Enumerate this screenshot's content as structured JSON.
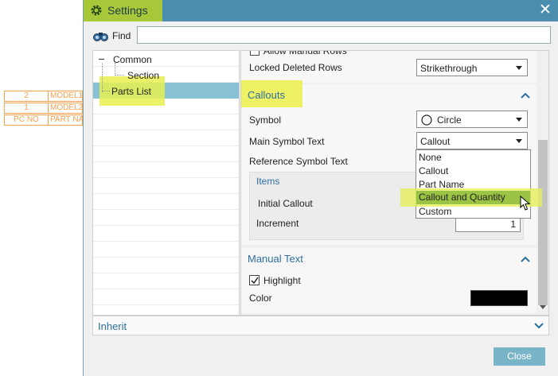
{
  "background_table": {
    "rows": [
      [
        "2",
        "MODEL1"
      ],
      [
        "1",
        "MODEL2"
      ],
      [
        "PC NO",
        "PART NA"
      ]
    ]
  },
  "dialog": {
    "title": "Settings",
    "find_label": "Find",
    "find_value": "",
    "tree": {
      "items": [
        {
          "label": "Common",
          "expander": "−"
        },
        {
          "label": "Section"
        },
        {
          "label": "Parts List"
        }
      ]
    },
    "rows_section": {
      "partial_label": "Allow Manual Rows",
      "locked_deleted_rows_label": "Locked Deleted Rows",
      "locked_deleted_rows_value": "Strikethrough"
    },
    "callouts": {
      "title": "Callouts",
      "symbol_label": "Symbol",
      "symbol_value": "Circle",
      "main_symbol_text_label": "Main Symbol Text",
      "main_symbol_text_value": "Callout",
      "reference_symbol_text_label": "Reference Symbol Text",
      "items_title": "Items",
      "initial_callout_label": "Initial Callout",
      "increment_label": "Increment",
      "increment_value": "1",
      "dropdown_options": [
        "None",
        "Callout",
        "Part Name",
        "Callout and Quantity",
        "Custom"
      ]
    },
    "manual_text": {
      "title": "Manual Text",
      "highlight_label": "Highlight",
      "highlight_checked": true,
      "color_label": "Color",
      "color_value": "#000000"
    },
    "inherit_label": "Inherit",
    "close_button": "Close"
  }
}
